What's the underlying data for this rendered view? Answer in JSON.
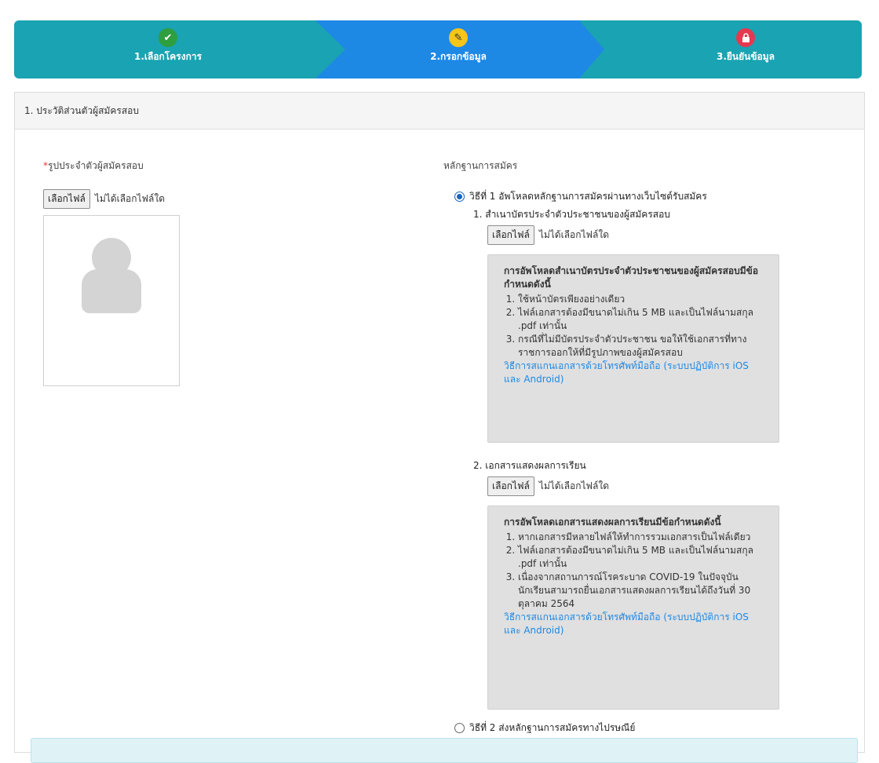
{
  "wizard": {
    "steps": [
      {
        "label": "1.เลือกโครงการ",
        "icon": "check-icon",
        "color": "#2e9e3f",
        "glyph": "✔"
      },
      {
        "label": "2.กรอกข้อมูล",
        "icon": "pencil-icon",
        "color": "#f5c518",
        "glyph": "✎"
      },
      {
        "label": "3.ยืนยันข้อมูล",
        "icon": "lock-icon",
        "color": "#e53950",
        "glyph": "🔒"
      }
    ],
    "active_index": 1
  },
  "section": {
    "title": "1. ประวัติส่วนตัวผู้สมัครสอบ"
  },
  "photo": {
    "required_mark": "*",
    "label": "รูปประจำตัวผู้สมัครสอบ",
    "choose_button": "เลือกไฟล์",
    "no_file_text": "ไม่ได้เลือกไฟล์ใด"
  },
  "evidence": {
    "heading": "หลักฐานการสมัคร",
    "method1": "วิธีที่ 1 อัพโหลดหลักฐานการสมัครผ่านทางเว็บไซต์รับสมัคร",
    "method2": "วิธีที่ 2 ส่งหลักฐานการสมัครทางไปรษณีย์",
    "documents": [
      {
        "title": "1. สำเนาบัตรประจำตัวประชาชนของผู้สมัครสอบ",
        "choose_button": "เลือกไฟล์",
        "no_file_text": "ไม่ได้เลือกไฟล์ใด",
        "info_title": "การอัพโหลดสำเนาบัตรประจำตัวประชาชนของผู้สมัครสอบมีข้อกำหนดดังนี้",
        "rules": [
          "ใช้หน้าบัตรเพียงอย่างเดียว",
          "ไฟล์เอกสารต้องมีขนาดไม่เกิน 5 MB และเป็นไฟล์นามสกุล .pdf เท่านั้น",
          "กรณีที่ไม่มีบัตรประจำตัวประชาชน ขอให้ใช้เอกสารที่ทางราชการออกให้ที่มีรูปภาพของผู้สมัครสอบ"
        ],
        "link": "วิธีการสแกนเอกสารด้วยโทรศัพท์มือถือ (ระบบปฏิบัติการ iOS และ Android)"
      },
      {
        "title": "2. เอกสารแสดงผลการเรียน",
        "choose_button": "เลือกไฟล์",
        "no_file_text": "ไม่ได้เลือกไฟล์ใด",
        "info_title": "การอัพโหลดเอกสารแสดงผลการเรียนมีข้อกำหนดดังนี้",
        "rules": [
          "หากเอกสารมีหลายไฟล์ให้ทำการรวมเอกสารเป็นไฟล์เดียว",
          "ไฟล์เอกสารต้องมีขนาดไม่เกิน 5 MB และเป็นไฟล์นามสกุล .pdf เท่านั้น",
          "เนื่องจากสถานการณ์โรคระบาด COVID-19 ในปัจจุบัน นักเรียนสามารถยื่นเอกสารแสดงผลการเรียนได้ถึงวันที่ 30 ตุลาคม 2564"
        ],
        "link": "วิธีการสแกนเอกสารด้วยโทรศัพท์มือถือ (ระบบปฏิบัติการ iOS และ Android)"
      }
    ]
  }
}
